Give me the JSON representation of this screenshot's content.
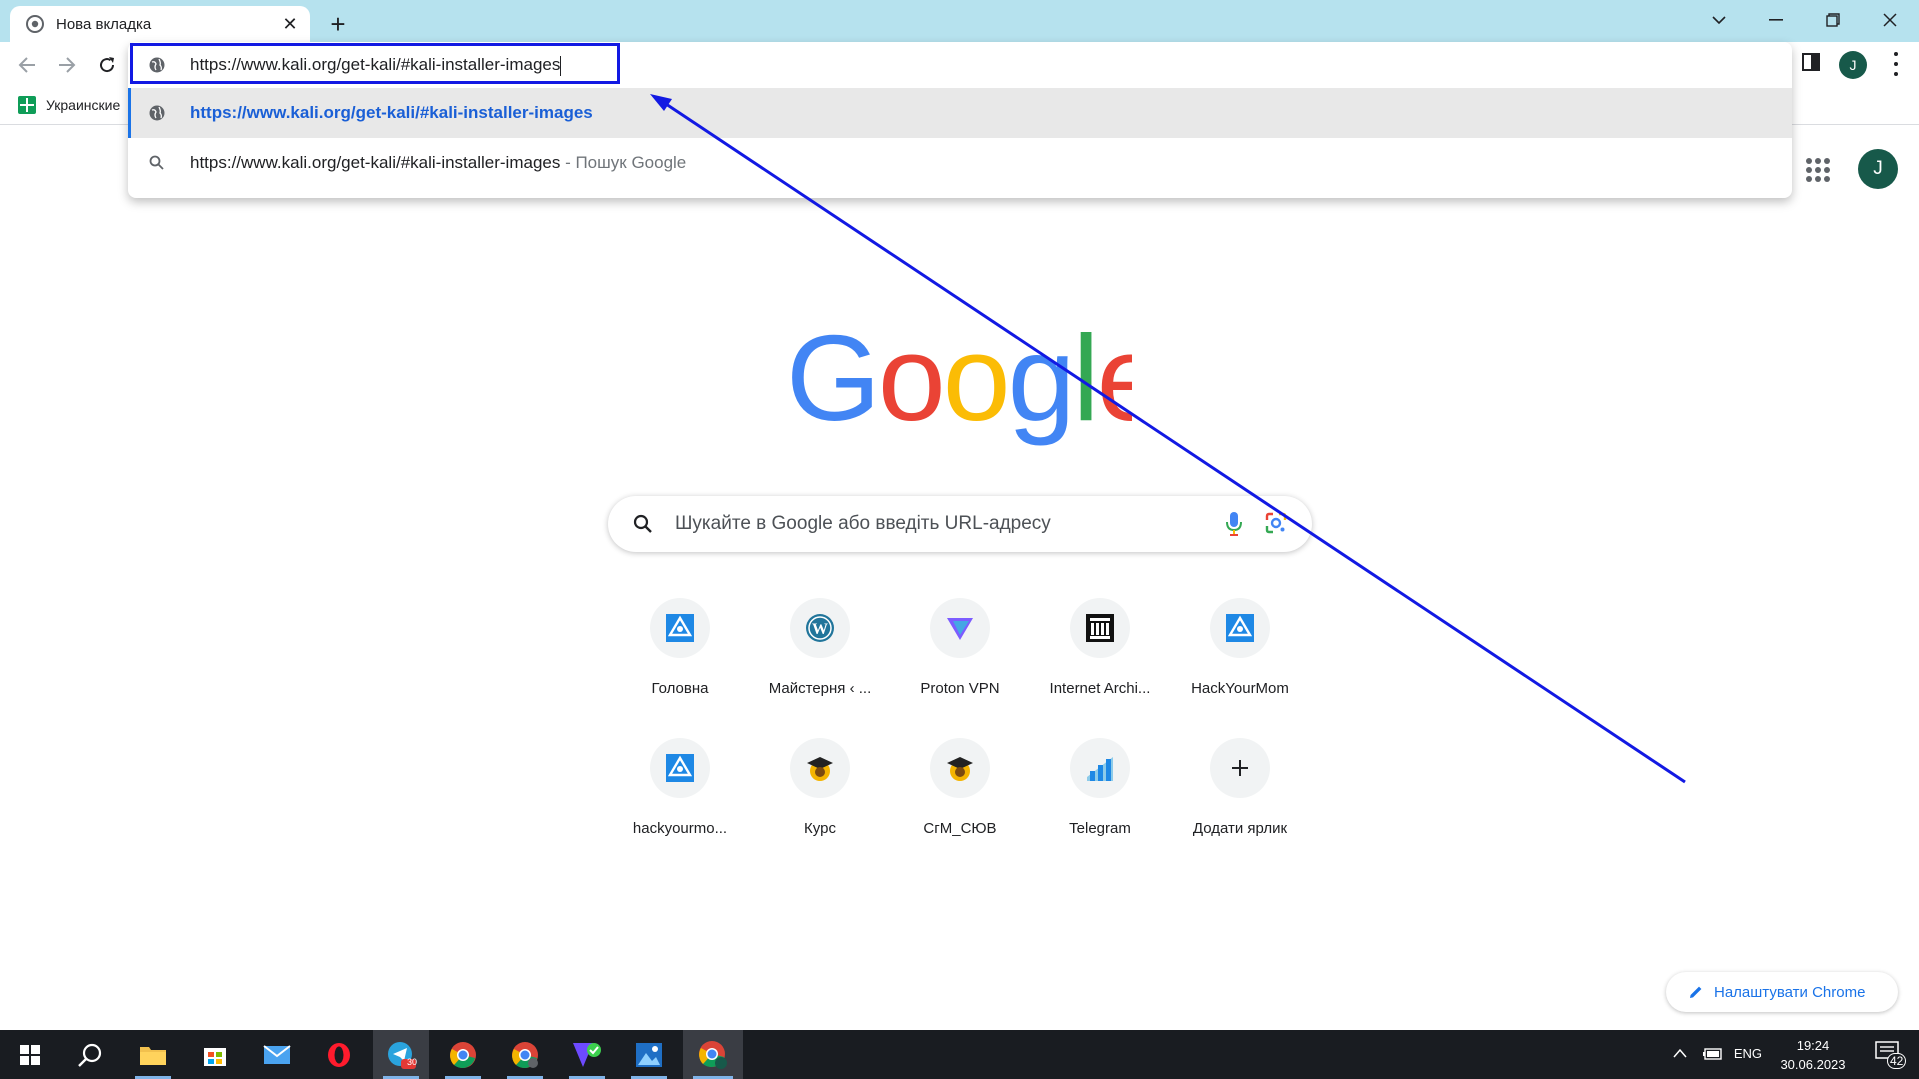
{
  "tab": {
    "title": "Нова вкладка"
  },
  "omnibox": {
    "input_value": "https://www.kali.org/get-kali/#kali-installer-images",
    "suggestions": [
      {
        "text": "https://www.kali.org/get-kali/#kali-installer-images",
        "suffix": ""
      },
      {
        "text": "https://www.kali.org/get-kali/#kali-installer-images",
        "suffix": " - Пошук Google"
      }
    ]
  },
  "profile": {
    "initial": "J"
  },
  "bookmarks": [
    {
      "label": "Украинские"
    }
  ],
  "search": {
    "placeholder": "Шукайте в Google або введіть URL-адресу"
  },
  "shortcuts": [
    {
      "label": "Головна",
      "icon": "hackyourmom-icon"
    },
    {
      "label": "Майстерня ‹ ...",
      "icon": "wordpress-icon"
    },
    {
      "label": "Proton VPN",
      "icon": "protonvpn-icon"
    },
    {
      "label": "Internet Archi...",
      "icon": "internet-archive-icon"
    },
    {
      "label": "HackYourMom",
      "icon": "hackyourmom-icon"
    },
    {
      "label": "hackyourmo...",
      "icon": "hackyourmom-icon"
    },
    {
      "label": "Курс",
      "icon": "graduation-icon"
    },
    {
      "label": "СгМ_СЮВ",
      "icon": "graduation-icon"
    },
    {
      "label": "Telegram",
      "icon": "telegram-chart-icon"
    },
    {
      "label": "Додати ярлик",
      "icon": "plus-icon"
    }
  ],
  "customize": {
    "label": "Налаштувати Chrome"
  },
  "taskbar": {
    "telegram_badge": "30",
    "lang": "ENG",
    "time": "19:24",
    "date": "30.06.2023",
    "notifications": "42"
  },
  "colors": {
    "titlebar": "#b6e2ee",
    "annotation": "#1219e3",
    "link_blue": "#1a5fd6",
    "taskbar": "#191c21"
  }
}
